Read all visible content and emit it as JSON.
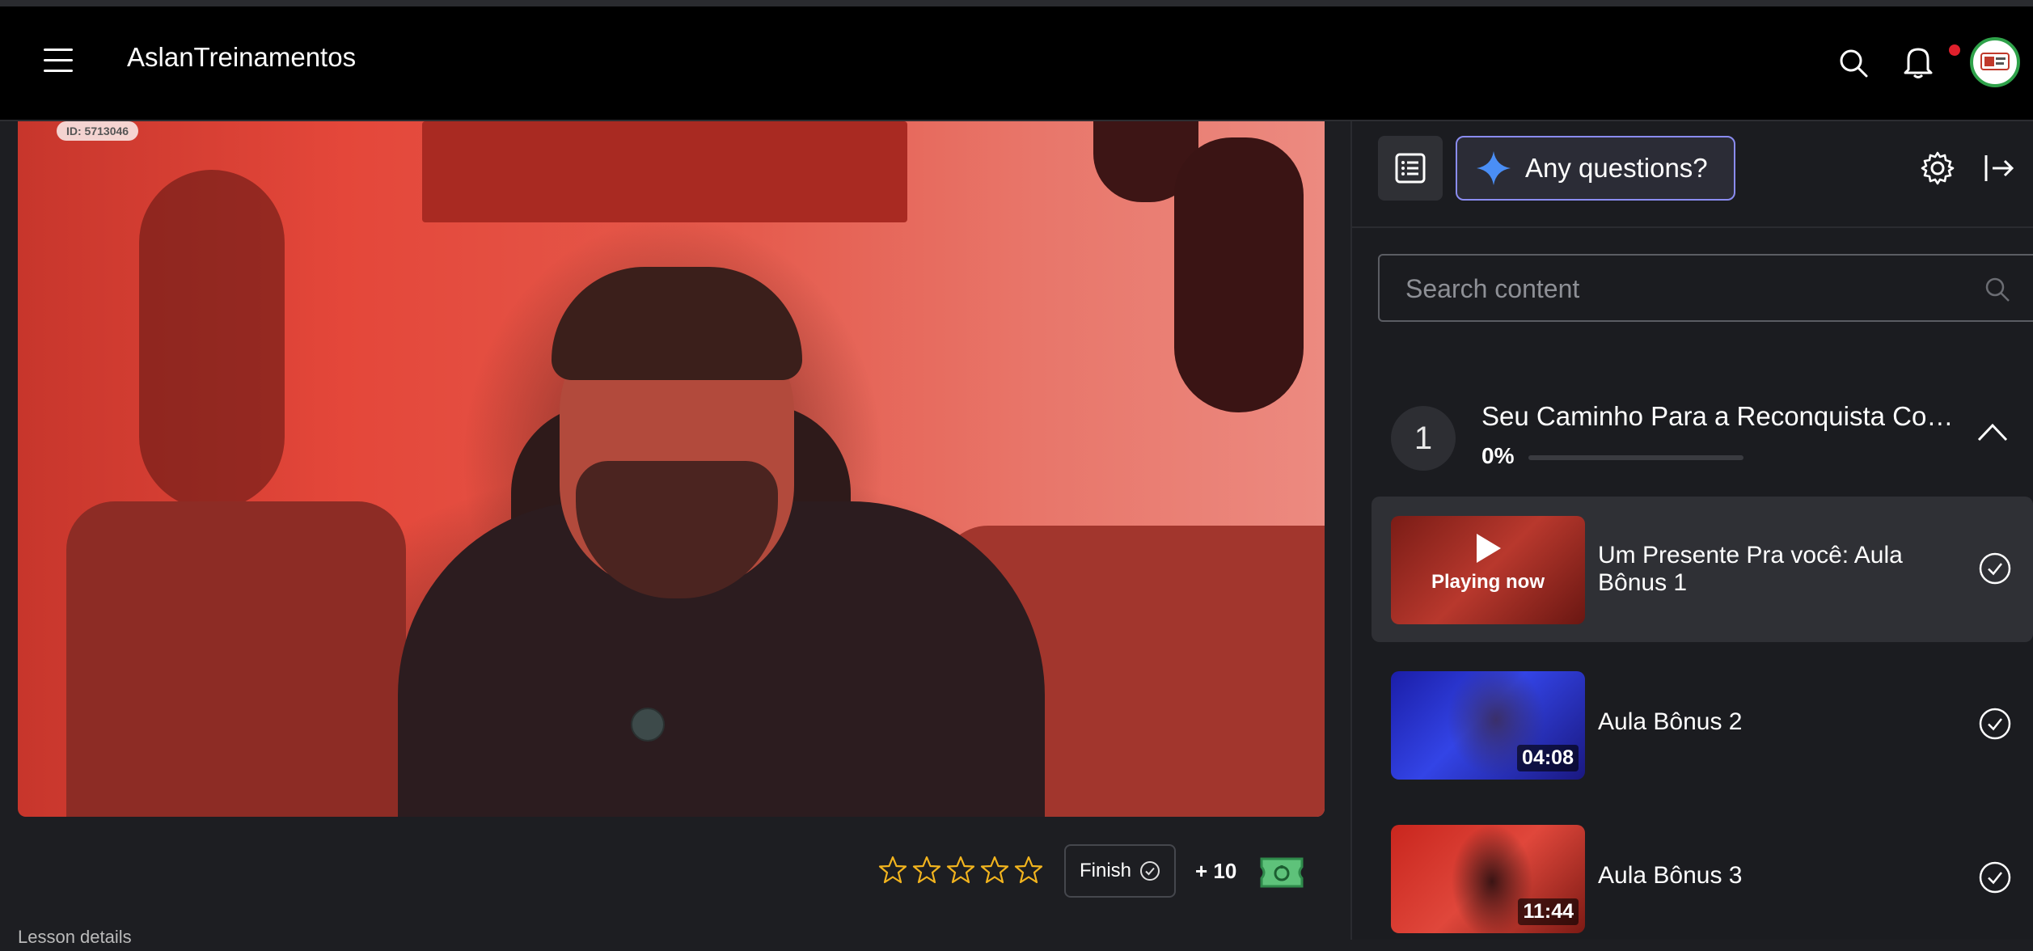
{
  "header": {
    "brand": "AslanTreinamentos",
    "icons": [
      "menu-icon",
      "search-icon",
      "bell-icon",
      "avatar"
    ],
    "notification_dot_color": "#e0202c"
  },
  "video": {
    "watermark_id": "ID: 5713046"
  },
  "rating": {
    "stars_total": 5,
    "stars_filled": 0,
    "star_color": "#f2b41e"
  },
  "actions": {
    "finish_label": "Finish",
    "points_label": "+ 10"
  },
  "below_video_text": "Lesson details",
  "sidebar": {
    "ask_label": "Any questions?",
    "ask_border_color": "#8a8cf0",
    "search_placeholder": "Search content",
    "module": {
      "number": "1",
      "title": "Seu Caminho Para a Reconquista Começ...",
      "progress_label": "0%",
      "progress": 0
    },
    "lessons": [
      {
        "title": "Um Presente Pra você: Aula Bônus 1",
        "status": "Playing now",
        "duration": "",
        "active": true
      },
      {
        "title": "Aula Bônus 2",
        "status": "",
        "duration": "04:08",
        "active": false
      },
      {
        "title": "Aula Bônus 3",
        "status": "",
        "duration": "11:44",
        "active": false
      }
    ]
  }
}
